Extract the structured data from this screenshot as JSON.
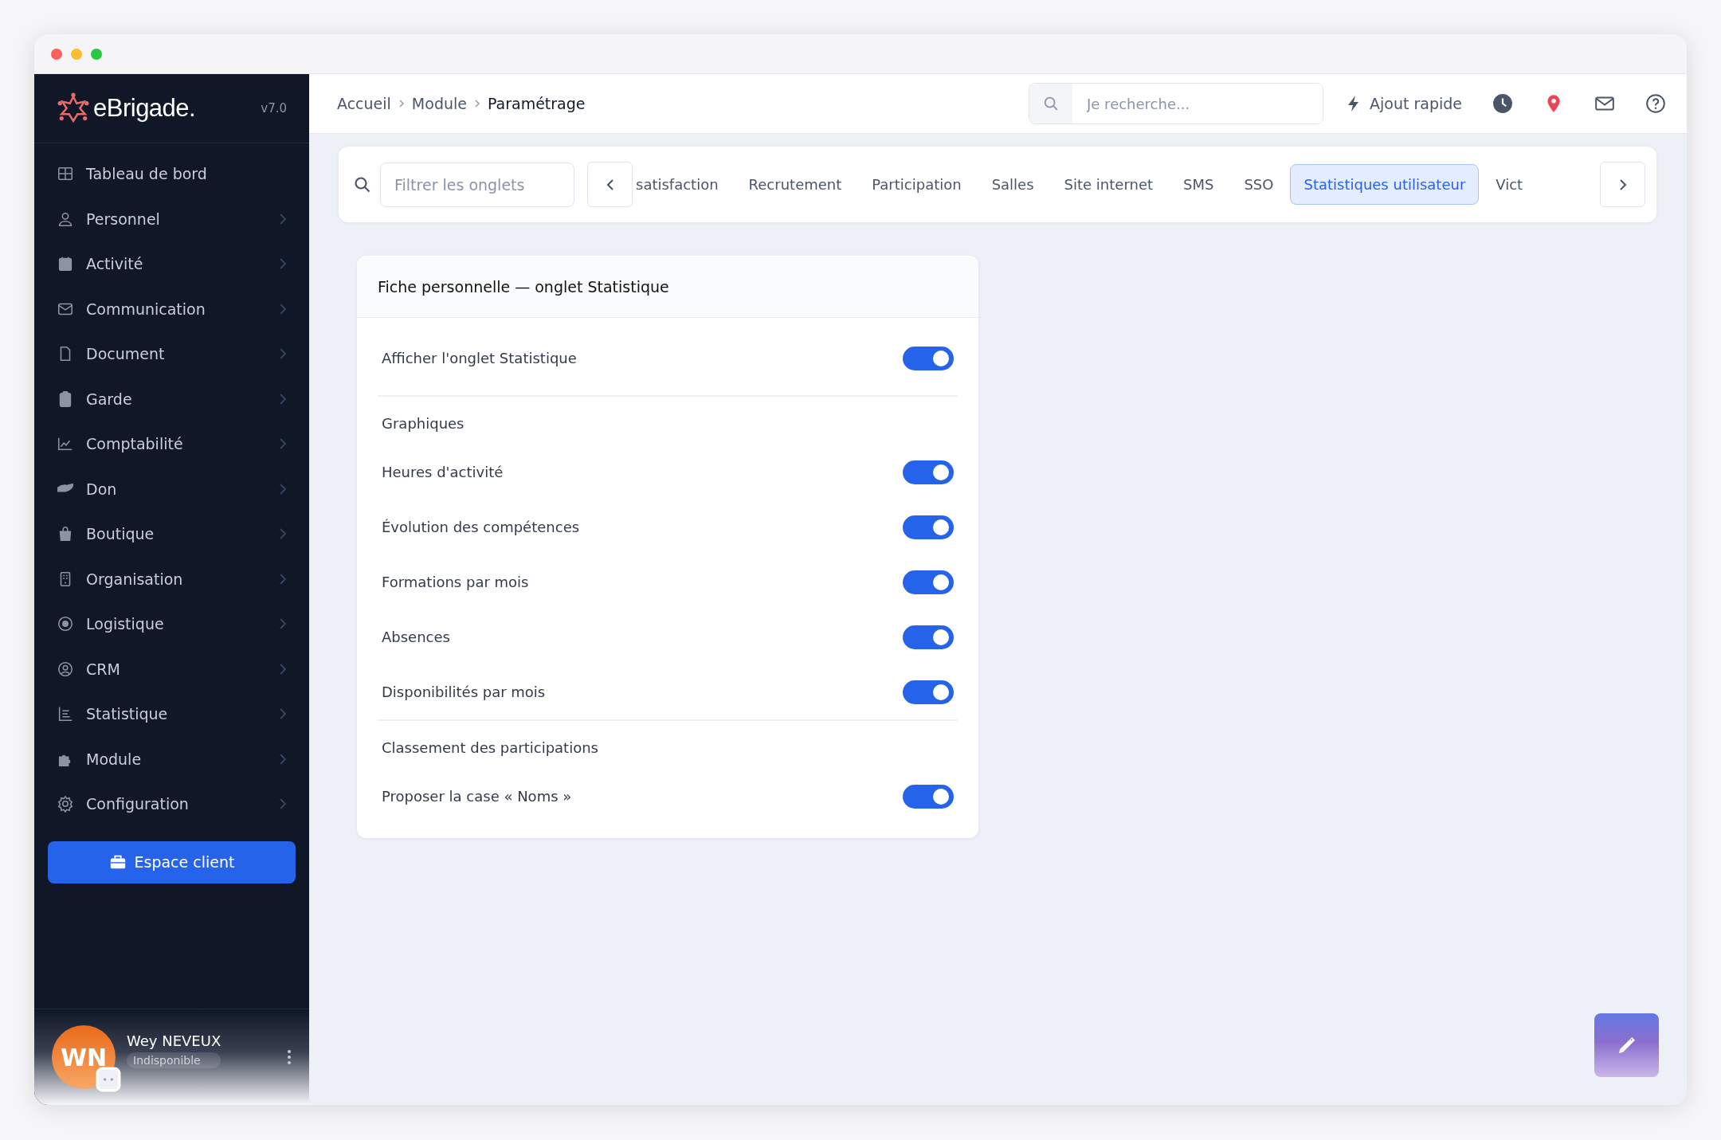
{
  "sidebar": {
    "logo": "eBrigade.",
    "version": "v7.0",
    "items": [
      {
        "label": "Tableau de bord",
        "has_submenu": false
      },
      {
        "label": "Personnel",
        "has_submenu": true
      },
      {
        "label": "Activité",
        "has_submenu": true
      },
      {
        "label": "Communication",
        "has_submenu": true
      },
      {
        "label": "Document",
        "has_submenu": true
      },
      {
        "label": "Garde",
        "has_submenu": true
      },
      {
        "label": "Comptabilité",
        "has_submenu": true
      },
      {
        "label": "Don",
        "has_submenu": true
      },
      {
        "label": "Boutique",
        "has_submenu": true
      },
      {
        "label": "Organisation",
        "has_submenu": true
      },
      {
        "label": "Logistique",
        "has_submenu": true
      },
      {
        "label": "CRM",
        "has_submenu": true
      },
      {
        "label": "Statistique",
        "has_submenu": true
      },
      {
        "label": "Module",
        "has_submenu": true
      },
      {
        "label": "Configuration",
        "has_submenu": true
      }
    ],
    "client_button": "Espace client",
    "user": {
      "initials": "WN",
      "name": "Wey NEVEUX",
      "status": "Indisponible"
    }
  },
  "header": {
    "breadcrumb": [
      "Accueil",
      "Module",
      "Paramétrage"
    ],
    "search": {
      "placeholder": "Je recherche..."
    },
    "quick_add": "Ajout rapide"
  },
  "tabs_bar": {
    "filter": {
      "placeholder": "Filtrer les onglets"
    },
    "tabs": [
      {
        "label": "satisfaction",
        "selected": false
      },
      {
        "label": "Recrutement",
        "selected": false
      },
      {
        "label": "Participation",
        "selected": false
      },
      {
        "label": "Salles",
        "selected": false
      },
      {
        "label": "Site internet",
        "selected": false
      },
      {
        "label": "SMS",
        "selected": false
      },
      {
        "label": "SSO",
        "selected": false
      },
      {
        "label": "Statistiques utilisateur",
        "selected": true
      },
      {
        "label": "Vict",
        "selected": false
      }
    ]
  },
  "card": {
    "title": "Fiche personnelle — onglet Statistique",
    "sections": [
      {
        "rows": [
          {
            "label": "Afficher l'onglet Statistique",
            "on": true
          }
        ]
      },
      {
        "heading": "Graphiques",
        "rows": [
          {
            "label": "Heures d'activité",
            "on": true
          },
          {
            "label": "Évolution des compétences",
            "on": true
          },
          {
            "label": "Formations par mois",
            "on": true
          },
          {
            "label": "Absences",
            "on": true
          },
          {
            "label": "Disponibilités par mois",
            "on": true
          }
        ]
      },
      {
        "heading": "Classement des participations",
        "rows": [
          {
            "label": "Proposer la case « Noms »",
            "on": true
          }
        ]
      }
    ]
  }
}
